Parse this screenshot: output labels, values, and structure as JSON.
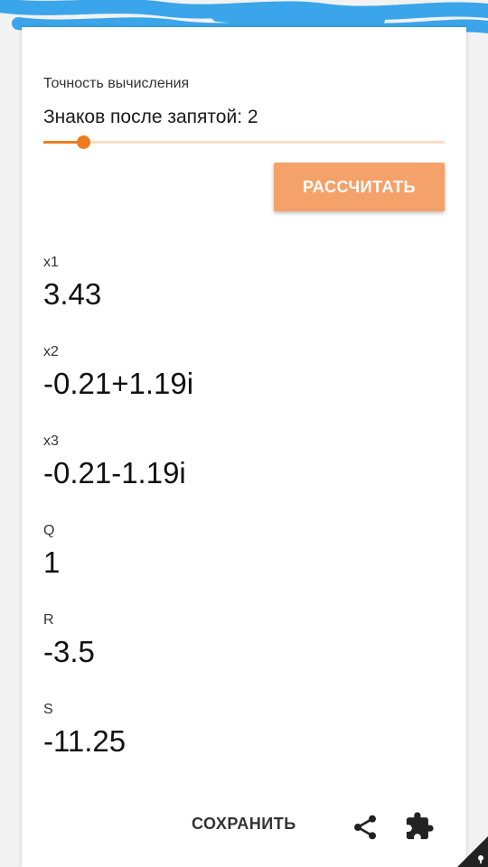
{
  "settings": {
    "precision_label": "Точность вычисления",
    "digits_text": "Знаков после запятой: 2",
    "slider_fraction": 0.1
  },
  "calculate_label": "РАССЧИТАТЬ",
  "results": [
    {
      "label": "x1",
      "value": "3.43"
    },
    {
      "label": "x2",
      "value": "-0.21+1.19i"
    },
    {
      "label": "x3",
      "value": "-0.21-1.19i"
    },
    {
      "label": "Q",
      "value": "1"
    },
    {
      "label": "R",
      "value": "-3.5"
    },
    {
      "label": "S",
      "value": "-11.25"
    }
  ],
  "footer": {
    "save_label": "СОХРАНИТЬ"
  },
  "icons": [
    "share-icon",
    "puzzle-icon",
    "corner-icon"
  ],
  "colors": {
    "accent": "#ef7b1f",
    "button": "#f5a26a",
    "track": "#f6dfc6",
    "scribble": "#3aa5ea"
  }
}
